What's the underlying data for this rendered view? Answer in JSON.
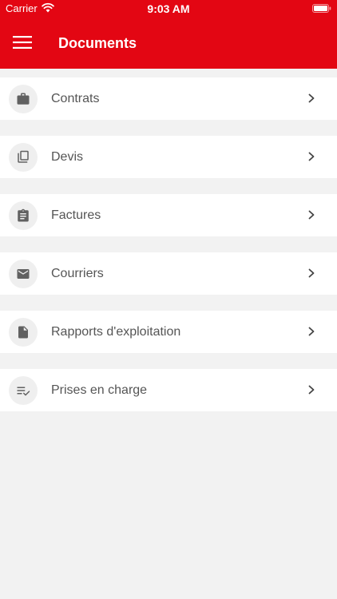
{
  "status_bar": {
    "carrier": "Carrier",
    "time": "9:03 AM"
  },
  "header": {
    "title": "Documents",
    "menu_icon": "hamburger-menu-icon"
  },
  "colors": {
    "header_bg": "#e30613",
    "background": "#f2f2f2",
    "row_bg": "#ffffff",
    "text": "#555555",
    "icon": "#616161"
  },
  "items": [
    {
      "label": "Contrats",
      "icon": "briefcase-icon"
    },
    {
      "label": "Devis",
      "icon": "copy-icon"
    },
    {
      "label": "Factures",
      "icon": "clipboard-icon"
    },
    {
      "label": "Courriers",
      "icon": "mail-icon"
    },
    {
      "label": "Rapports d'exploitation",
      "icon": "document-icon"
    },
    {
      "label": "Prises en charge",
      "icon": "checklist-icon"
    }
  ]
}
